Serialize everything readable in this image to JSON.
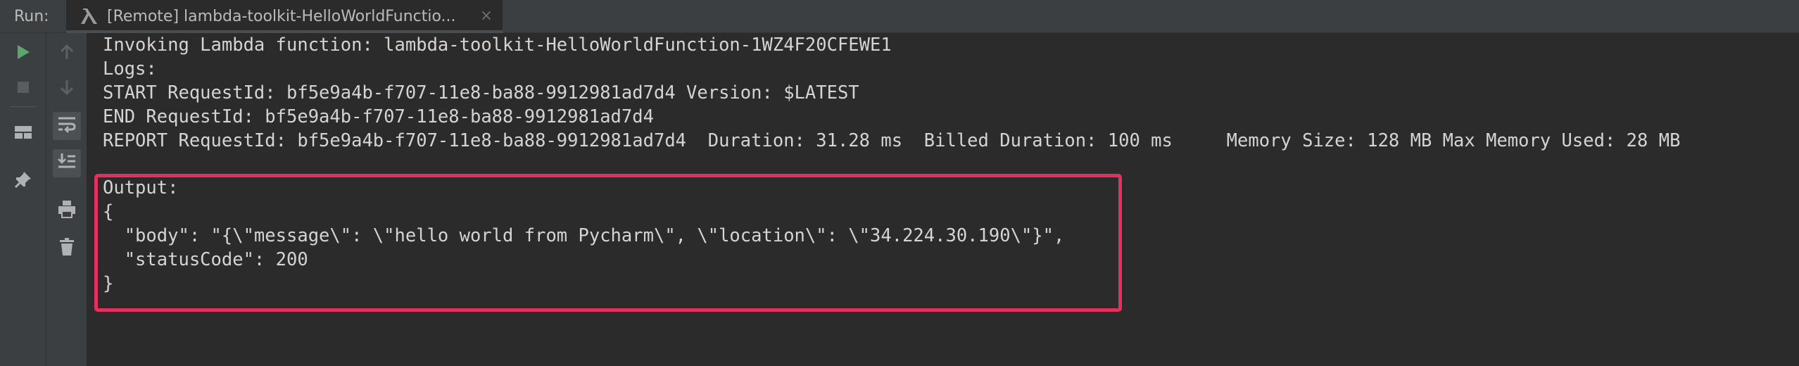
{
  "tabbar": {
    "run_label": "Run:",
    "tab_title": "[Remote] lambda-toolkit-HelloWorldFunctio..."
  },
  "toolbar": {
    "buttons": [
      {
        "icon": "run-icon",
        "color": "#59a869"
      },
      {
        "icon": "stop-icon"
      },
      {
        "icon": "layout-icon"
      },
      {
        "icon": "pin-icon"
      },
      {
        "icon": "up-arrow-icon"
      },
      {
        "icon": "down-arrow-icon"
      },
      {
        "icon": "soft-wrap-icon"
      },
      {
        "icon": "scroll-to-end-icon"
      },
      {
        "icon": "print-icon"
      },
      {
        "icon": "trash-icon"
      }
    ]
  },
  "console": {
    "line1": "Invoking Lambda function: lambda-toolkit-HelloWorldFunction-1WZ4F20CFEWE1",
    "line2": "Logs:",
    "line3": "START RequestId: bf5e9a4b-f707-11e8-ba88-9912981ad7d4 Version: $LATEST",
    "line4": "END RequestId: bf5e9a4b-f707-11e8-ba88-9912981ad7d4",
    "line5": "REPORT RequestId: bf5e9a4b-f707-11e8-ba88-9912981ad7d4  Duration: 31.28 ms  Billed Duration: 100 ms     Memory Size: 128 MB Max Memory Used: 28 MB",
    "line6": "Output:",
    "line7": "{",
    "line8": "  \"body\": \"{\\\"message\\\": \\\"hello world from Pycharm\\\", \\\"location\\\": \\\"34.224.30.190\\\"}\",",
    "line9": "  \"statusCode\": 200",
    "line10": "}"
  },
  "colors": {
    "highlight": "#e4305a",
    "background": "#2b2b2b",
    "panel": "#3c3f41",
    "text": "#d4d4d4"
  }
}
